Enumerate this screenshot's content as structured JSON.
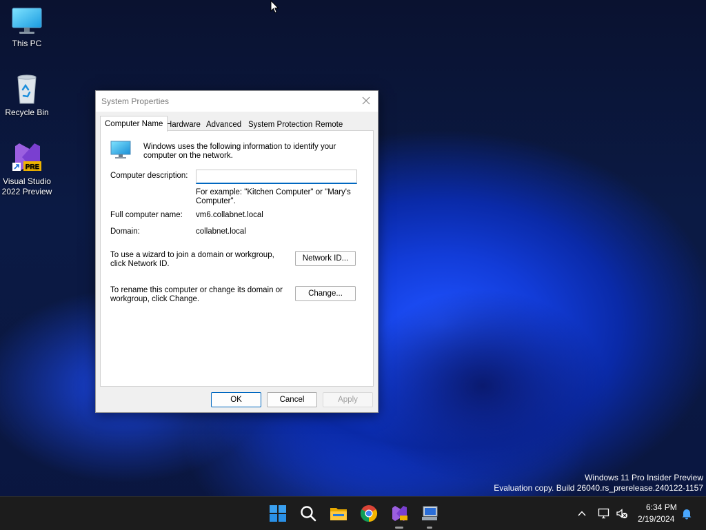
{
  "desktop": {
    "icons": [
      {
        "label": "This PC"
      },
      {
        "label": "Recycle Bin"
      },
      {
        "label_line1": "Visual Studio",
        "label_line2": "2022 Preview",
        "badge": "PRE"
      }
    ]
  },
  "dialog": {
    "title": "System Properties",
    "tabs": [
      "Computer Name",
      "Hardware",
      "Advanced",
      "System Protection",
      "Remote"
    ],
    "intro_text": "Windows uses the following information to identify your computer on the network.",
    "description_label": "Computer description:",
    "description_value": "",
    "example_text": "For example: \"Kitchen Computer\" or \"Mary's Computer\".",
    "full_name_label": "Full computer name:",
    "full_name_value": "vm6.collabnet.local",
    "domain_label": "Domain:",
    "domain_value": "collabnet.local",
    "network_id_text": "To use a wizard to join a domain or workgroup, click Network ID.",
    "network_id_button": "Network ID...",
    "rename_text": "To rename this computer or change its domain or workgroup, click Change.",
    "change_button": "Change...",
    "ok_button": "OK",
    "cancel_button": "Cancel",
    "apply_button": "Apply"
  },
  "watermark": {
    "line1": "Windows 11 Pro Insider Preview",
    "line2": "Evaluation copy. Build 26040.rs_prerelease.240122-1157"
  },
  "taskbar": {
    "icons": [
      "windows-start-icon",
      "search-icon",
      "file-explorer-icon",
      "chrome-icon",
      "visual-studio-icon",
      "system-properties-icon"
    ],
    "time": "6:34 PM",
    "date": "2/19/2024"
  },
  "colors": {
    "accent": "#0067c0",
    "taskbar": "#1c1c1c",
    "wallpaper_blue": "#1f52ff"
  }
}
